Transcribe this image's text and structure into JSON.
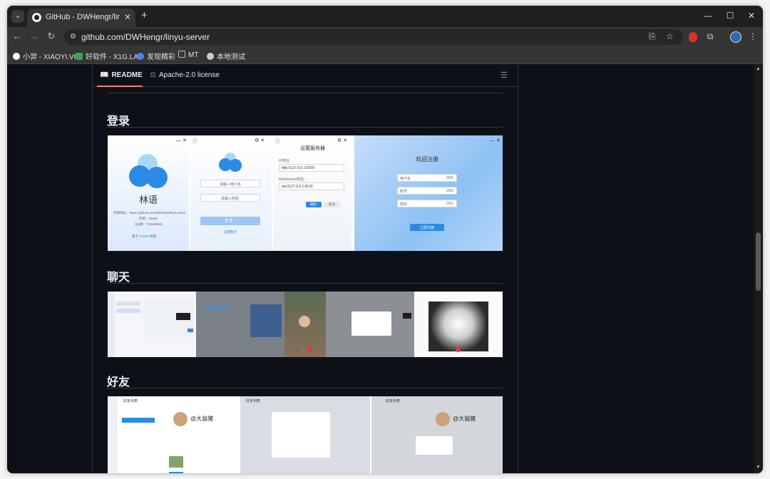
{
  "browser": {
    "tab_title": "GitHub - DWHengr/linyu-server",
    "url": "github.com/DWHengr/linyu-server",
    "bookmarks": [
      {
        "label": "小羿 - XIAOYI.VC",
        "color": "#ffffff"
      },
      {
        "label": "好软件 - X1G.LA",
        "color": "#34a853"
      },
      {
        "label": "发现精彩",
        "color": "#4285f4"
      },
      {
        "label": "MT",
        "color": "#9e9e9e"
      },
      {
        "label": "本地测试",
        "color": "#cccccc"
      }
    ]
  },
  "readme": {
    "tab_readme": "README",
    "tab_license": "Apache-2.0 license",
    "sections": [
      {
        "heading": "登录"
      },
      {
        "heading": "聊天"
      },
      {
        "heading": "好友"
      }
    ]
  },
  "login_shots": {
    "app_name": "林语",
    "app_link": "开源地址：https://github.com/DWHengr/linyu-client",
    "author": "作者：Heath",
    "qq": "QQ群：729158695",
    "powered_left": "基于",
    "powered_brand": "TAURI",
    "powered_right": "构建",
    "username_placeholder": "请输入用户名",
    "password_placeholder": "请输入密码",
    "login_btn": "登 录",
    "register_link": "注册账户",
    "server_title": "设置服务器",
    "ip_label": "IP地址:",
    "ip_value": "http://127.0.0.1:9200",
    "ws_label": "WebSocket地址:",
    "ws_value": "ws://127.0.0.1:9100",
    "confirm_btn": "确定",
    "cancel_btn": "取消",
    "register_title": "欢迎注册",
    "reg_field1": "用户名",
    "reg_field2": "账号",
    "reg_field3": "密码",
    "reg_count1": "0/30",
    "reg_count2": "0/30",
    "reg_count3": "0/16",
    "reg_btn": "立即注册"
  },
  "friend_shots": {
    "list_title": "好友列表",
    "profile_name": "@大翁猪"
  }
}
